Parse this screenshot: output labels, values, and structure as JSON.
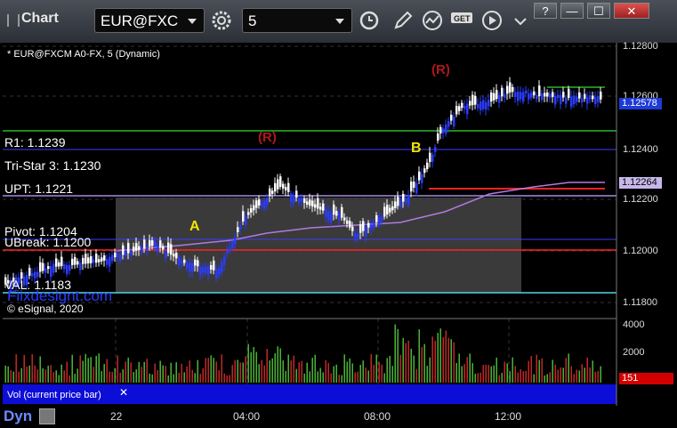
{
  "window": {
    "title": "Chart"
  },
  "toolbar": {
    "symbol": "EUR@FXC",
    "interval": "5"
  },
  "window_buttons": {
    "help": "?",
    "minimize": "—",
    "maximize": "☐",
    "close": "✕"
  },
  "chart": {
    "symbol_label": "* EUR@FXCM A0-FX, 5 (Dynamic)",
    "levels": {
      "r1": "R1: 1.1239",
      "tristar": "Tri-Star 3: 1.1230",
      "upt": "UPT: 1.1221",
      "pivot": "Pivot: 1.1204",
      "ubreak": "UBreak: 1.1200",
      "val": "VAL: 1.1183"
    },
    "markers": {
      "a": "A",
      "b": "B",
      "r_upper": "(R)",
      "r_lower": "(R)"
    },
    "watermark": "© eSignal, 2020",
    "brand": "Fiixdesignt.com",
    "price_axis": [
      "1.12800",
      "1.12600",
      "1.12400",
      "1.12200",
      "1.12000",
      "1.11800"
    ],
    "last_price": "1.12578",
    "avg_price": "1.12264",
    "volume_axis": [
      "4000",
      "2000"
    ],
    "volume_last": "151",
    "volume_label": "Vol (current price bar)",
    "time_axis": [
      "22",
      "04:00",
      "08:00",
      "12:00"
    ],
    "footer": "Dyn",
    "colors": {
      "bull": "#ffffff",
      "bear": "#2a3bff",
      "r1": "#2bb52b",
      "pivot": "#ff2222",
      "avg": "#b07ae0"
    }
  }
}
